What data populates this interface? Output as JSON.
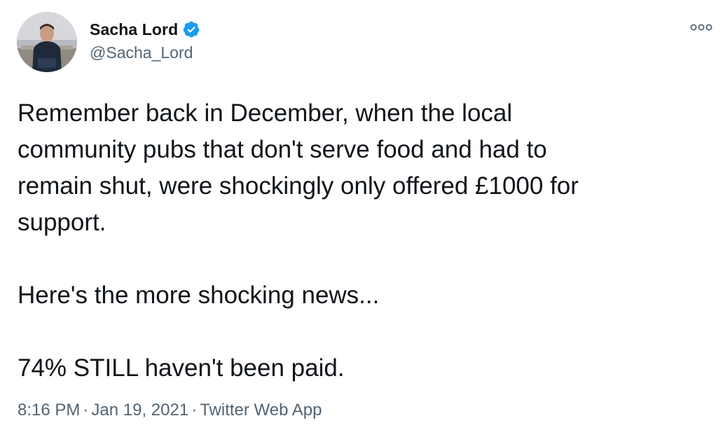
{
  "author": {
    "display_name": "Sacha Lord",
    "handle": "@Sacha_Lord",
    "verified": true,
    "avatar_icon": "profile-photo",
    "verified_icon": "verified-badge-icon"
  },
  "tweet": {
    "paragraphs": [
      "Remember back in December, when the local\ncommunity pubs that don't serve food and had to\nremain shut, were shockingly only offered £1000 for\nsupport.",
      "Here's the more shocking news...",
      "74% STILL haven't been paid."
    ]
  },
  "meta": {
    "time": "8:16 PM",
    "date": "Jan 19, 2021",
    "separator": "·",
    "source": "Twitter Web App"
  },
  "colors": {
    "text_primary": "#0f1419",
    "text_secondary": "#536471",
    "verified_blue": "#1d9bf0"
  }
}
